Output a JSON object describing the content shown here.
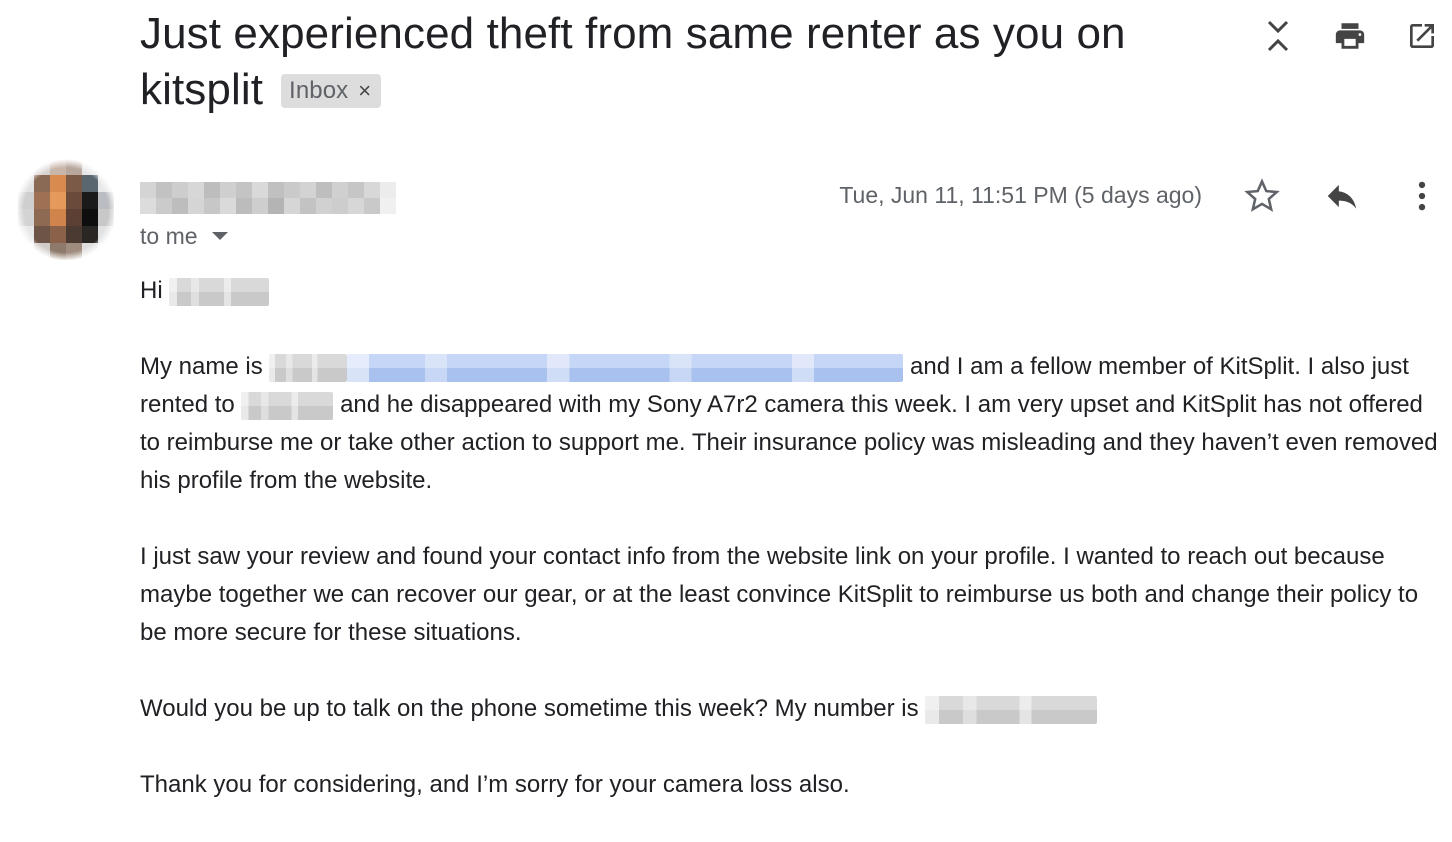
{
  "subject": {
    "title": "Just experienced theft from same renter as you on kitsplit",
    "label": "Inbox",
    "label_remove": "×"
  },
  "header_icons": {
    "collapse": "collapse-all-icon",
    "print": "print-icon",
    "new_window": "open-in-new-window-icon"
  },
  "message": {
    "recipient_line": "to me",
    "date": "Tue, Jun 11, 11:51 PM (5 days ago)",
    "actions": [
      "star-icon",
      "reply-icon",
      "more-vert-icon"
    ]
  },
  "body": {
    "greeting": "Hi",
    "p1_a": "My name is",
    "p1_b": "and I am a fellow member of KitSplit. I also just rented to",
    "p1_c": "and he disappeared with my Sony A7r2 camera this week. I am very upset and KitSplit has not offered to reimburse me or take other action to support me. Their insurance policy was misleading and they haven’t even removed his profile from the website.",
    "p2": "I just saw your review and found your contact info from the website link on your profile. I wanted to reach out because maybe together we can recover our gear, or at the least convince KitSplit to reimburse us both and change their policy to be more secure for these situations.",
    "p3": "Would you be up to talk on the phone sometime this week? My number is",
    "p4": "Thank you for considering, and I’m sorry for your camera loss also."
  },
  "colors": {
    "text": "#202124",
    "secondary": "#5f6368",
    "chip_bg": "#dddddd",
    "link_blur": "#a9c1ef"
  }
}
